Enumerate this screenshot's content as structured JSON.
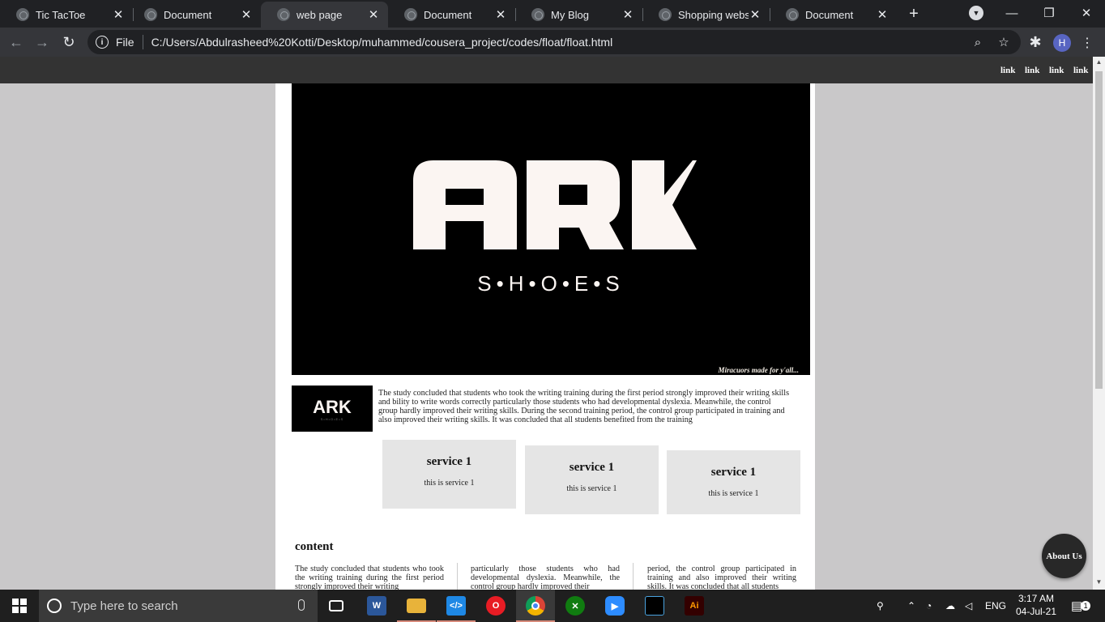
{
  "browser": {
    "tabs": [
      {
        "title": "Tic TacToe",
        "active": false
      },
      {
        "title": "Document",
        "active": false
      },
      {
        "title": "web page",
        "active": true
      },
      {
        "title": "Document",
        "active": false
      },
      {
        "title": "My Blog",
        "active": false
      },
      {
        "title": "Shopping website",
        "active": false
      },
      {
        "title": "Document",
        "active": false
      }
    ],
    "close_glyph": "✕",
    "new_tab_glyph": "+",
    "scheme_label": "File",
    "url": "C:/Users/Abdulrasheed%20Kotti/Desktop/muhammed/cousera_project/codes/float/float.html",
    "profile_initial": "H"
  },
  "page": {
    "nav_links": [
      "link",
      "link",
      "link",
      "link"
    ],
    "hero_caption": "Miracuors made for y'all...",
    "logo": {
      "wordmark": "ARK",
      "tagline": "S•H•O•E•S"
    },
    "intro_text": "The study concluded that students who took the writing training during the first period strongly improved their writing skills and bility to write words correctly particularly those students who had developmental dyslexia. Meanwhile, the control group hardly improved their writing skills. During the second training period, the control group participated in training and also improved their writing skills. It was concluded that all students benefited from the training",
    "services": [
      {
        "title": "service 1",
        "text": "this is service 1"
      },
      {
        "title": "service 1",
        "text": "this is service 1"
      },
      {
        "title": "service 1",
        "text": "this is service 1"
      }
    ],
    "content_heading": "content",
    "content_columns": [
      "The study concluded that students who took the writing training during the first period strongly improved their writing",
      "particularly those students who had developmental dyslexia. Meanwhile, the control group hardly improved their",
      "period, the control group participated in training and also improved their writing skills. It was concluded that all students"
    ],
    "about_button": "About Us"
  },
  "taskbar": {
    "search_placeholder": "Type here to search",
    "language": "ENG",
    "time": "3:17 AM",
    "date": "04-Jul-21",
    "notification_count": "1",
    "apps": [
      "task-view",
      "word",
      "file-explorer",
      "vscode",
      "opera",
      "chrome",
      "xbox",
      "zoom",
      "terminal",
      "illustrator"
    ]
  },
  "colors": {
    "tab_bar": "#202124",
    "toolbar": "#35363a",
    "page_bg": "#c9c8c9",
    "site_nav": "#333333",
    "service_card": "#e5e5e5",
    "hero_bg": "#000000",
    "logo_fill": "#fbf5f2"
  }
}
